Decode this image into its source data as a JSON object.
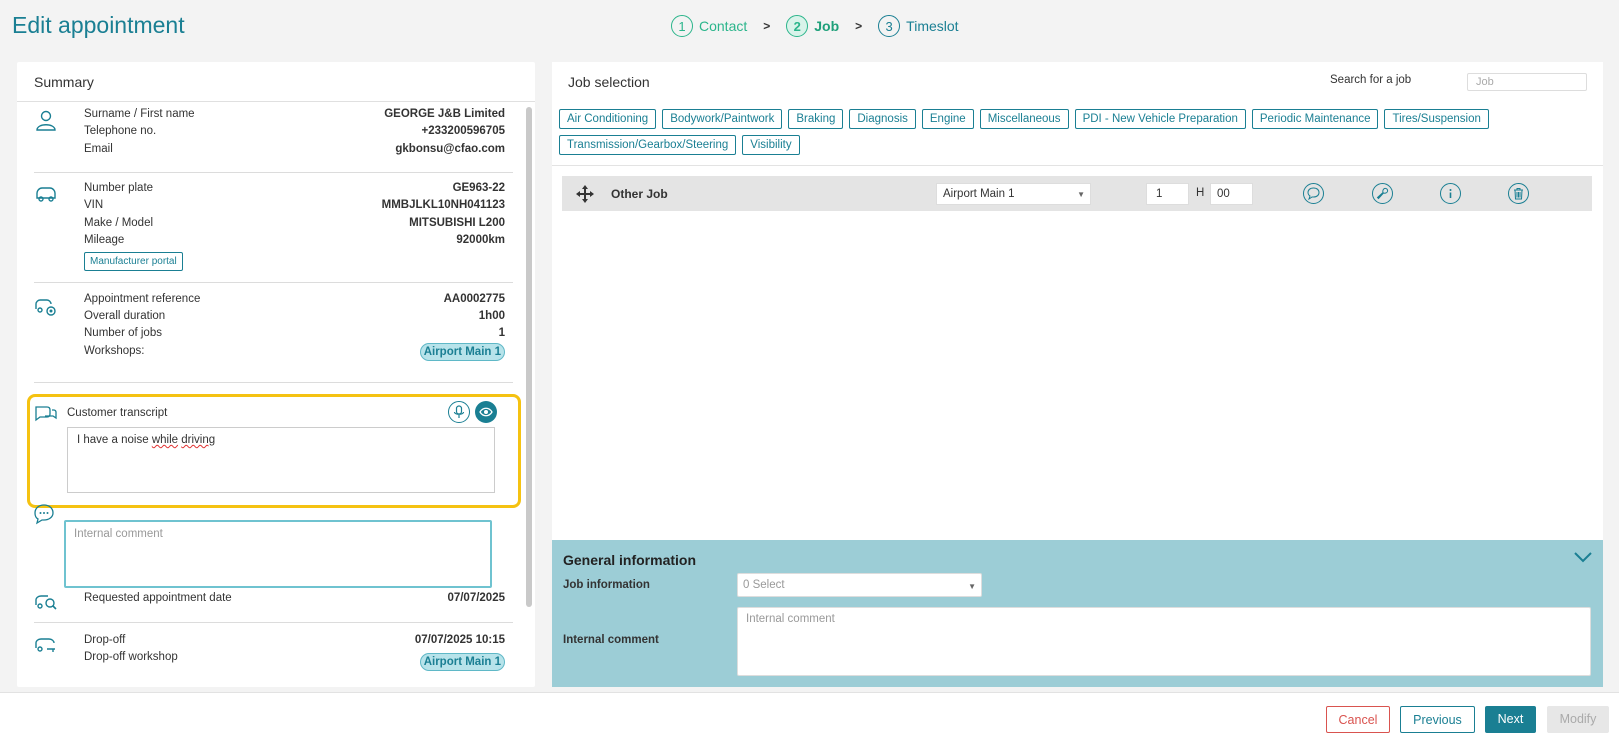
{
  "header": {
    "title": "Edit appointment",
    "steps": [
      {
        "num": "1",
        "label": "Contact"
      },
      {
        "num": "2",
        "label": "Job"
      },
      {
        "num": "3",
        "label": "Timeslot"
      }
    ],
    "separator": ">"
  },
  "summary": {
    "title": "Summary",
    "customer": {
      "name_label": "Surname / First name",
      "name_value": "GEORGE J&B Limited",
      "phone_label": "Telephone no.",
      "phone_value": "+233200596705",
      "email_label": "Email",
      "email_value": "gkbonsu@cfao.com"
    },
    "vehicle": {
      "plate_label": "Number plate",
      "plate_value": "GE963-22",
      "vin_label": "VIN",
      "vin_value": "MMBJLKL10NH041123",
      "model_label": "Make / Model",
      "model_value": "MITSUBISHI L200",
      "mileage_label": "Mileage",
      "mileage_value": "92000km",
      "portal_button": "Manufacturer portal"
    },
    "appointment": {
      "ref_label": "Appointment reference",
      "ref_value": "AA0002775",
      "duration_label": "Overall duration",
      "duration_value": "1h00",
      "jobs_label": "Number of jobs",
      "jobs_value": "1",
      "workshops_label": "Workshops:",
      "workshop_value": "Airport Main 1"
    },
    "transcript": {
      "label": "Customer transcript",
      "text_before": "I have a noise ",
      "text_err1": "while",
      "text_space": " ",
      "text_err2": "driving"
    },
    "internal_comment_placeholder": "Internal comment",
    "requested": {
      "label": "Requested appointment date",
      "value": "07/07/2025"
    },
    "dropoff": {
      "label": "Drop-off",
      "value": "07/07/2025 10:15",
      "workshop_label": "Drop-off workshop",
      "workshop_value": "Airport Main 1"
    }
  },
  "jobs": {
    "title": "Job selection",
    "search_label": "Search for a job",
    "search_placeholder": "Job",
    "categories": [
      "Air Conditioning",
      "Bodywork/Paintwork",
      "Braking",
      "Diagnosis",
      "Engine",
      "Miscellaneous",
      "PDI - New Vehicle Preparation",
      "Periodic Maintenance",
      "Tires/Suspension",
      "Transmission/Gearbox/Steering",
      "Visibility"
    ],
    "job_row": {
      "name": "Other Job",
      "workshop": "Airport Main 1",
      "hours": "1",
      "h_label": "H",
      "minutes": "00"
    }
  },
  "general_info": {
    "title": "General information",
    "job_info_label": "Job information",
    "job_info_select": "0 Select",
    "internal_comment_label": "Internal comment",
    "internal_comment_placeholder": "Internal comment"
  },
  "footer": {
    "cancel": "Cancel",
    "previous": "Previous",
    "next": "Next",
    "modify": "Modify"
  },
  "colors": {
    "accent": "#1a7f93",
    "step_green": "#2bb58b",
    "highlight": "#f5c211",
    "general_info_bg": "#9ccdd6",
    "cancel_red": "#d9534f"
  }
}
